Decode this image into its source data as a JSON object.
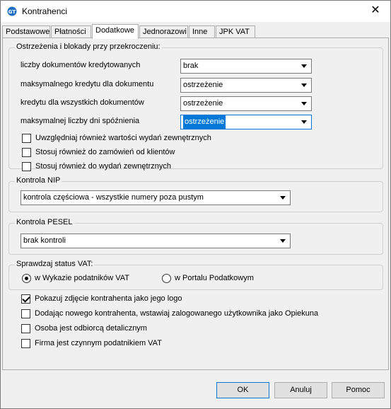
{
  "window": {
    "title": "Kontrahenci",
    "app_icon_text": "GT",
    "close_glyph": "✕"
  },
  "tabs": [
    {
      "label": "Podstawowe",
      "active": false
    },
    {
      "label": "Płatności",
      "active": false
    },
    {
      "label": "Dodatkowe",
      "active": true
    },
    {
      "label": "Jednorazowi",
      "active": false
    },
    {
      "label": "Inne",
      "active": false
    },
    {
      "label": "JPK VAT",
      "active": false
    }
  ],
  "warnings": {
    "title": "Ostrzeżenia i blokady przy przekroczeniu:",
    "rows": [
      {
        "label": "liczby dokumentów kredytowanych",
        "value": "brak"
      },
      {
        "label": "maksymalnego kredytu dla  dokumentu",
        "value": "ostrzeżenie"
      },
      {
        "label": "kredytu dla wszystkich dokumentów",
        "value": "ostrzeżenie"
      },
      {
        "label": "maksymalnej liczby dni spóźnienia",
        "value": "ostrzeżenie"
      }
    ],
    "checkboxes": [
      {
        "label": "Uwzględniaj również wartości wydań zewnętrznych",
        "checked": false
      },
      {
        "label": "Stosuj również do zamówień od klientów",
        "checked": false
      },
      {
        "label": "Stosuj również do wydań zewnętrznych",
        "checked": false
      }
    ]
  },
  "nip": {
    "title": "Kontrola NIP",
    "value": "kontrola częściowa - wszystkie numery poza pustym"
  },
  "pesel": {
    "title": "Kontrola PESEL",
    "value": "brak kontroli"
  },
  "vat": {
    "title": "Sprawdzaj status VAT:",
    "options": [
      {
        "label": "w Wykazie podatników VAT",
        "selected": true
      },
      {
        "label": "w Portalu Podatkowym",
        "selected": false
      }
    ]
  },
  "options": [
    {
      "label": "Pokazuj zdjęcie kontrahenta jako jego logo",
      "checked": true
    },
    {
      "label": "Dodając nowego kontrahenta, wstawiaj zalogowanego użytkownika jako Opiekuna",
      "checked": false
    },
    {
      "label": "Osoba jest odbiorcą detalicznym",
      "checked": false
    },
    {
      "label": "Firma jest czynnym podatnikiem VAT",
      "checked": false
    }
  ],
  "buttons": {
    "ok": "OK",
    "cancel": "Anuluj",
    "help": "Pomoc"
  },
  "colors": {
    "accent": "#0078d7",
    "selection": "#0078d7"
  }
}
